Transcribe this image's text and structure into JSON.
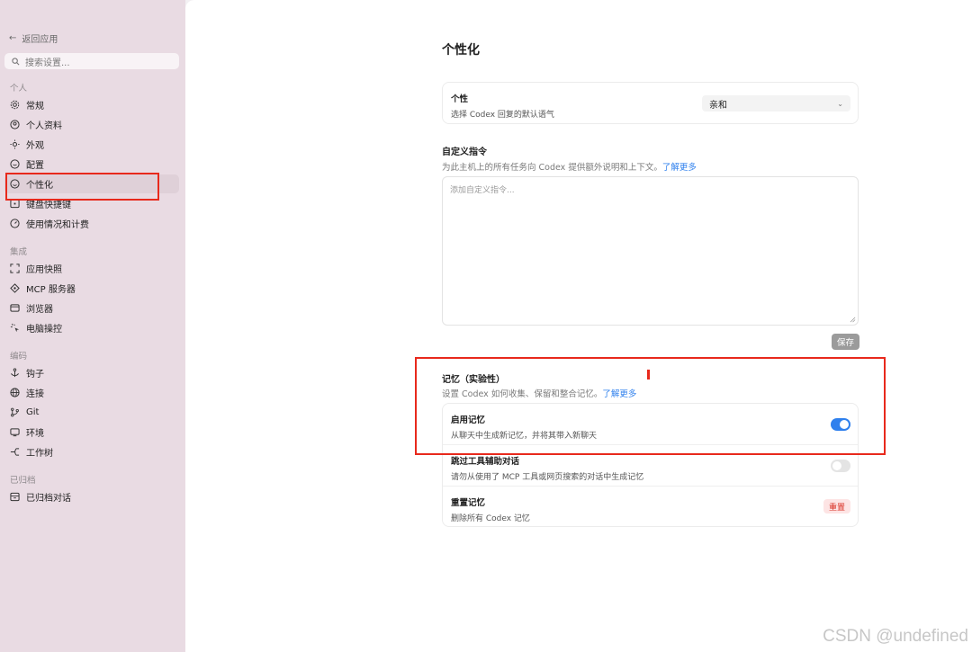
{
  "sidebar": {
    "back_label": "返回应用",
    "search_placeholder": "搜索设置...",
    "sections": {
      "personal": "个人",
      "integrations": "集成",
      "coding": "编码",
      "archived": "已归档"
    },
    "items": {
      "general": "常规",
      "profile": "个人资料",
      "appearance": "外观",
      "config": "配置",
      "personalization": "个性化",
      "shortcuts": "键盘快捷键",
      "usage": "使用情况和计费",
      "snapshots": "应用快照",
      "mcp": "MCP 服务器",
      "browser": "浏览器",
      "computer_control": "电脑操控",
      "hooks": "钩子",
      "connections": "连接",
      "git": "Git",
      "environments": "环境",
      "worktrees": "工作树",
      "archived_chats": "已归档对话"
    }
  },
  "main": {
    "title": "个性化",
    "personality": {
      "label": "个性",
      "desc": "选择 Codex 回复的默认语气",
      "selected": "亲和"
    },
    "custom_instructions": {
      "heading": "自定义指令",
      "desc": "为此主机上的所有任务向 Codex 提供额外说明和上下文。",
      "link": "了解更多",
      "placeholder": "添加自定义指令...",
      "save_label": "保存"
    },
    "memory": {
      "heading": "记忆（实验性）",
      "desc": "设置 Codex 如何收集、保留和整合记忆。",
      "link": "了解更多",
      "enable": {
        "label": "启用记忆",
        "desc": "从聊天中生成新记忆，并将其带入新聊天",
        "on": true
      },
      "skip_tools": {
        "label": "跳过工具辅助对话",
        "desc": "请勿从使用了 MCP 工具或网页搜索的对话中生成记忆",
        "on": false
      },
      "reset": {
        "label": "重置记忆",
        "desc": "删除所有 Codex 记忆",
        "button": "重置"
      }
    }
  },
  "watermark": "CSDN @undefined",
  "colors": {
    "sidebar_bg": "#e9dbe3",
    "accent_blue": "#2f80ed",
    "highlight_red": "#e8291c",
    "danger_red": "#d93025"
  }
}
